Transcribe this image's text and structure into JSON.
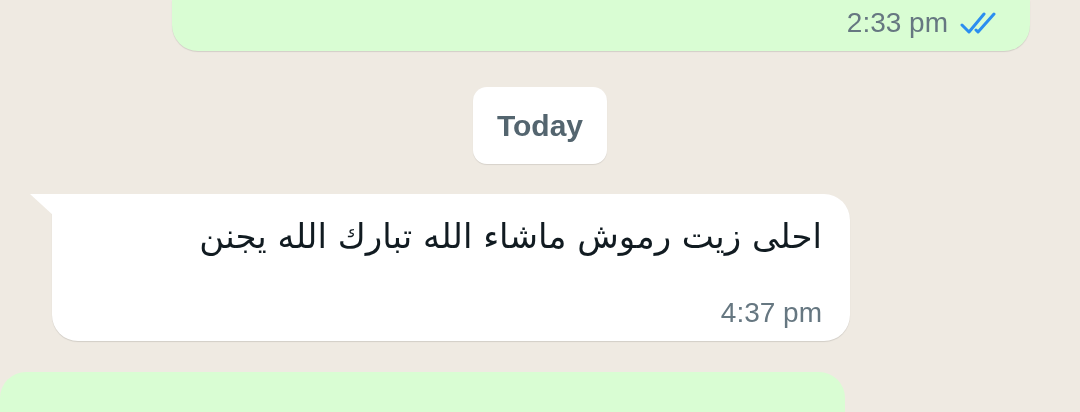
{
  "messages": [
    {
      "kind": "outgoing",
      "time": "2:33 pm",
      "read": true
    },
    {
      "kind": "date",
      "label": "Today"
    },
    {
      "kind": "incoming",
      "text": "احلى زيت رموش ماشاء الله تبارك الله يجنن",
      "time": "4:37 pm"
    },
    {
      "kind": "outgoing"
    }
  ]
}
